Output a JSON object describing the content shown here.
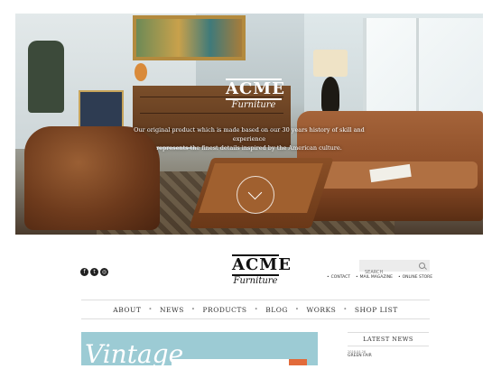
{
  "hero": {
    "logo_main": "ACME",
    "logo_sub": "Furniture",
    "tagline_line1": "Our original product which is made based on our 30 years history of skill and experience",
    "tagline_line2": "represents the finest details inspired by the American culture."
  },
  "header": {
    "social_icons": [
      "facebook-icon",
      "twitter-icon",
      "instagram-icon"
    ],
    "logo_main": "ACME",
    "logo_sub": "Furniture",
    "search_placeholder": "SEARCH",
    "sublinks": [
      "CONTACT",
      "MAIL MAGAZINE",
      "ONLINE STORE"
    ]
  },
  "nav": {
    "items": [
      "ABOUT",
      "NEWS",
      "PRODUCTS",
      "BLOG",
      "WORKS",
      "SHOP LIST"
    ]
  },
  "banner": {
    "word": "Vintage"
  },
  "latest_news": {
    "heading": "LATEST NEWS",
    "items": [
      {
        "date": "2016.04.26",
        "title": "GREEN FAIR"
      }
    ]
  },
  "colors": {
    "banner_bg": "#9ccbd4",
    "text": "#333333"
  }
}
